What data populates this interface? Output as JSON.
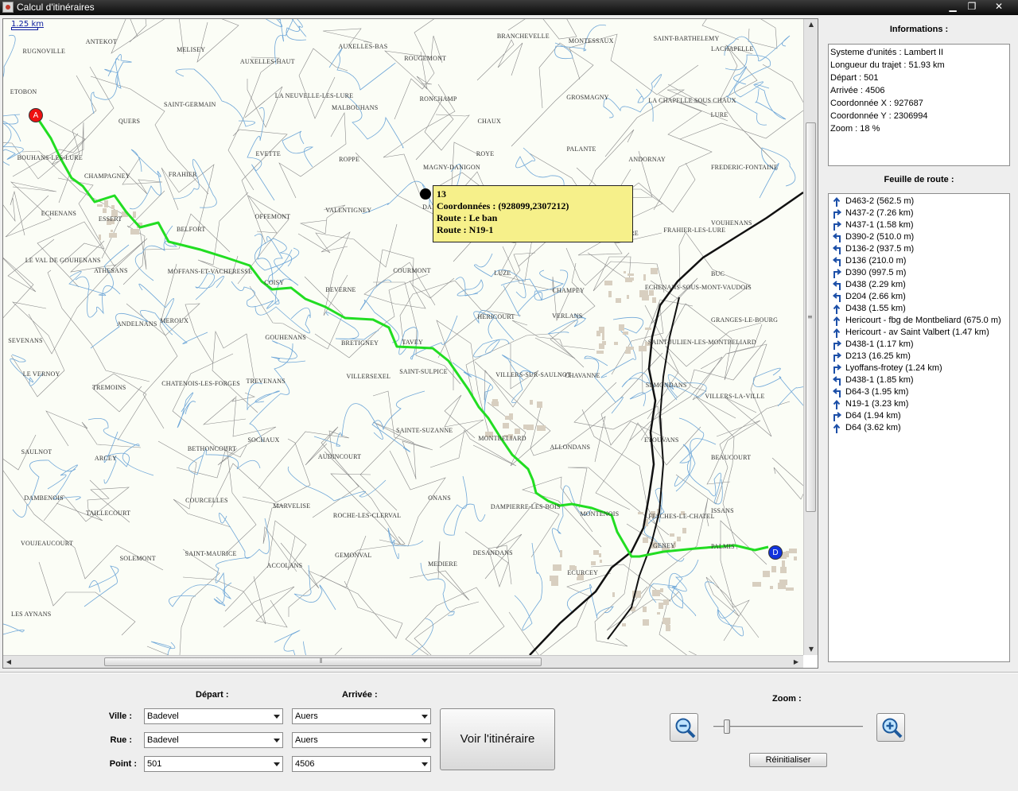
{
  "window": {
    "title": "Calcul d'itinéraires",
    "minimize_glyph": "▁",
    "maximize_glyph": "❐",
    "close_glyph": "✕"
  },
  "map": {
    "scale_label": "1.25 km",
    "route_color": "#22dd22",
    "rail_color": "#111111",
    "marker_start": "A",
    "marker_end": "D",
    "town_labels": [
      "RUGNOVILLE",
      "ANTEKOT",
      "MELISEY",
      "AUXELLES-HAUT",
      "AUXELLES-BAS",
      "ROUGEMONT",
      "BRANCHEVELLE",
      "MONTESSAUX",
      "SAINT-BARTHELEMY",
      "LACHAPELLE",
      "ETOBON",
      "QUERS",
      "SAINT-GERMAIN",
      "LA NEUVELLE-LES-LURE",
      "MALBOUHANS",
      "RONCHAMP",
      "CHAUX",
      "GROSMAGNY",
      "LA CHAPELLE SOUS CHAUX",
      "LURE",
      "BOUHANS-LES-LURE",
      "CHAMPAGNEY",
      "FRAHIER",
      "EVETTE",
      "ROPPE",
      "MAGNY-DANIGON",
      "ROYE",
      "PALANTE",
      "ANDORNAY",
      "FREDERIC-FONTAINE",
      "ECHENANS",
      "ESSERT",
      "BELFORT",
      "OFFEMONT",
      "VALENTIGNEY",
      "DANJOUTIN",
      "FROIDEVAL",
      "VYANS-LES-LURE",
      "FRAHIER-LES-LURE",
      "VOUHENANS",
      "LE VAL DE GOUHENANS",
      "ATHESANS",
      "MOFFANS-ET-VACHERESSE",
      "COISY",
      "BEVERNE",
      "COURMONT",
      "LUZE",
      "CHAMPEY",
      "ECHENANS-SOUS-MONT-VAUDOIS",
      "BUC",
      "SEVENANS",
      "ANDELNANS",
      "MEROUX",
      "GOUHENANS",
      "BRETIGNEY",
      "TAVEY",
      "HERICOURT",
      "VERLANS",
      "SAINT-JULIEN-LES-MONTBELIARD",
      "GRANGES-LE-BOURG",
      "LE VERNOY",
      "TREMOINS",
      "CHATENOIS-LES-FORGES",
      "TREVENANS",
      "VILLERSEXEL",
      "SAINT-SULPICE",
      "VILLERS-SUR-SAULNOT",
      "CHAVANNE",
      "SEMONDANS",
      "VILLERS-LA-VILLE",
      "SAULNOT",
      "ARCEY",
      "BETHONCOURT",
      "SOCHAUX",
      "AUDINCOURT",
      "SAINTE-SUZANNE",
      "MONTBELIARD",
      "ALLONDANS",
      "ETOUVANS",
      "BEAUCOURT",
      "DAMBENOIS",
      "TAILLECOURT",
      "COURCELLES",
      "MARVELISE",
      "ROCHE-LES-CLERVAL",
      "ONANS",
      "DAMPIERRE-LES-BOIS",
      "MONTENOIS",
      "FESCHES-LE-CHATEL",
      "ISSANS",
      "VOUJEAUCOURT",
      "SOLEMONT",
      "SAINT-MAURICE",
      "ACCOLANS",
      "GEMONVAL",
      "MEDIERE",
      "DESANDANS",
      "ECURCEY",
      "GENEY",
      "PALMIS",
      "LES AYNANS"
    ],
    "tooltip": {
      "line1": "13",
      "line2": "Coordonnées : (928099,2307212)",
      "line3": "Route : Le ban",
      "line4": "Route : N19-1"
    }
  },
  "info": {
    "title": "Informations :",
    "lines": [
      "Systeme d'unités : Lambert II",
      "Longueur du trajet : 51.93 km",
      "Départ : 501",
      "Arrivée : 4506",
      "Coordonnée X : 927687",
      "Coordonnée Y : 2306994",
      "Zoom : 18 %"
    ]
  },
  "roadmap": {
    "title": "Feuille de route :",
    "items": [
      {
        "icon": "straight-arrow-icon",
        "text": "D463-2 (562.5 m)"
      },
      {
        "icon": "turn-right-icon",
        "text": "N437-2 (7.26 km)"
      },
      {
        "icon": "turn-right-icon",
        "text": "N437-1 (1.58 km)"
      },
      {
        "icon": "turn-left-icon",
        "text": "D390-2 (510.0 m)"
      },
      {
        "icon": "turn-left-icon",
        "text": "D136-2 (937.5 m)"
      },
      {
        "icon": "turn-left-icon",
        "text": "D136 (210.0 m)"
      },
      {
        "icon": "turn-right-icon",
        "text": "D390 (997.5 m)"
      },
      {
        "icon": "turn-left-icon",
        "text": "D438 (2.29 km)"
      },
      {
        "icon": "turn-left-icon",
        "text": "D204 (2.66 km)"
      },
      {
        "icon": "straight-arrow-icon",
        "text": "D438 (1.55 km)"
      },
      {
        "icon": "straight-arrow-icon",
        "text": "Hericourt - fbg de Montbeliard (675.0 m)"
      },
      {
        "icon": "straight-arrow-icon",
        "text": "Hericourt - av Saint Valbert (1.47 km)"
      },
      {
        "icon": "turn-right-icon",
        "text": "D438-1 (1.17 km)"
      },
      {
        "icon": "turn-right-icon",
        "text": "D213 (16.25 km)"
      },
      {
        "icon": "turn-right-icon",
        "text": "Lyoffans-frotey (1.24 km)"
      },
      {
        "icon": "turn-left-icon",
        "text": "D438-1 (1.85 km)"
      },
      {
        "icon": "turn-left-icon",
        "text": "D64-3 (1.95 km)"
      },
      {
        "icon": "straight-arrow-icon",
        "text": "N19-1 (3.23 km)"
      },
      {
        "icon": "turn-right-icon",
        "text": "D64 (1.94 km)"
      },
      {
        "icon": "straight-arrow-icon",
        "text": "D64 (3.62 km)"
      }
    ]
  },
  "controls": {
    "depart_header": "Départ :",
    "arrivee_header": "Arrivée :",
    "ville_label": "Ville :",
    "rue_label": "Rue :",
    "point_label": "Point :",
    "depart": {
      "ville": "Badevel",
      "rue": "Badevel",
      "point": "501"
    },
    "arrivee": {
      "ville": "Auers",
      "rue": "Auers",
      "point": "4506"
    },
    "show_route_label": "Voir l'itinéraire",
    "zoom_header": "Zoom :",
    "zoom_level": 0.07,
    "reset_label": "Réinitialiser"
  }
}
